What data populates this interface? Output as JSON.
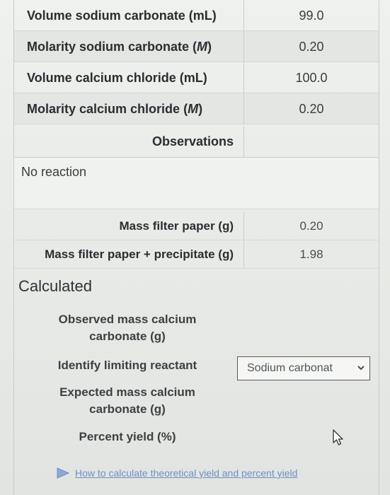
{
  "reagents": [
    {
      "label": "Volume sodium carbonate (mL)",
      "value": "99.0"
    },
    {
      "label_pre": "Molarity sodium carbonate (",
      "label_unit": "M",
      "label_post": ")",
      "value": "0.20"
    },
    {
      "label": "Volume calcium chloride (mL)",
      "value": "100.0"
    },
    {
      "label_pre": "Molarity calcium chloride (",
      "label_unit": "M",
      "label_post": ")",
      "value": "0.20"
    }
  ],
  "observations": {
    "header": "Observations",
    "text": "No reaction"
  },
  "masses": [
    {
      "label": "Mass filter paper (g)",
      "value": "0.20"
    },
    {
      "label": "Mass filter paper + precipitate (g)",
      "value": "1.98"
    }
  ],
  "calculated": {
    "title": "Calculated",
    "observed_mass_line1": "Observed mass calcium",
    "observed_mass_line2": "carbonate (g)",
    "limiting_label": "Identify limiting reactant",
    "limiting_selected": "Sodium carbonat",
    "expected_mass_line1": "Expected mass calcium",
    "expected_mass_line2": "carbonate (g)",
    "percent_yield_label": "Percent yield (%)"
  },
  "help_link": {
    "text": "How to calculate theoretical yield and percent yield",
    "icon": "video-play-icon",
    "color": "#6e8fc2"
  },
  "icons": {
    "dropdown": "chevron-down-icon",
    "cursor": "mouse-pointer-icon"
  }
}
